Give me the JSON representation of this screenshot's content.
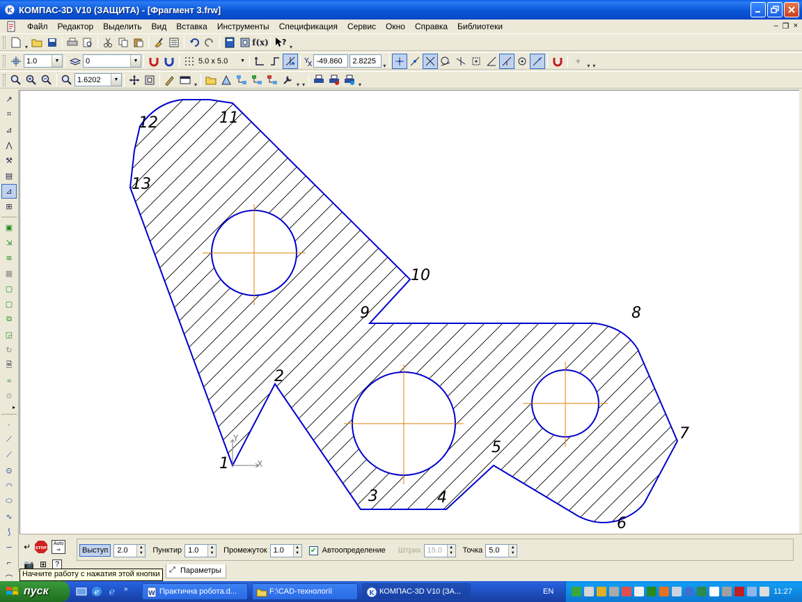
{
  "window": {
    "title": "КОМПАС-3D V10 (ЗАЩИТА) - [Фрагмент 3.frw]"
  },
  "menu": {
    "items": [
      "Файл",
      "Редактор",
      "Выделить",
      "Вид",
      "Вставка",
      "Инструменты",
      "Спецификация",
      "Сервис",
      "Окно",
      "Справка",
      "Библиотеки"
    ]
  },
  "toolbar2": {
    "step_value": "1.0",
    "layer_value": "0",
    "grid_value": "5.0 x 5.0",
    "coord_x_label": "X",
    "coord_y_label": "Y",
    "coord_x": "-49.860",
    "coord_y": "2.8225"
  },
  "toolbar3": {
    "zoom_value": "1.6202"
  },
  "drawing": {
    "labels": [
      "1",
      "2",
      "3",
      "4",
      "5",
      "6",
      "7",
      "8",
      "9",
      "10",
      "11",
      "12",
      "13"
    ],
    "axis_x_label": "X",
    "axis_y_label": "Y",
    "colors": {
      "outline": "#0000cc",
      "hatch": "#000000",
      "centerline": "#e08000",
      "axis": "#7a7a7a"
    }
  },
  "properties": {
    "vystup_label": "Выступ",
    "vystup_value": "2.0",
    "punktir_label": "Пунктир",
    "punktir_value": "1.0",
    "promezhutok_label": "Промежуток",
    "promezhutok_value": "1.0",
    "auto_label": "Автоопределение",
    "auto_checked": true,
    "shtrikh_label": "Штрих",
    "shtrikh_value": "15.0",
    "tochka_label": "Точка",
    "tochka_value": "5.0",
    "tab_label": "Параметры",
    "tooltip": "Начните работу с нажатия этой кнопки",
    "auto_button": "Auto",
    "stop_button": "STOP"
  },
  "taskbar": {
    "start_label": "пуск",
    "tasks": [
      "Практична робота.d...",
      "F:\\CAD-технології",
      "КОМПАС-3D V10 (ЗА..."
    ],
    "lang": "EN",
    "clock": "11:27"
  }
}
